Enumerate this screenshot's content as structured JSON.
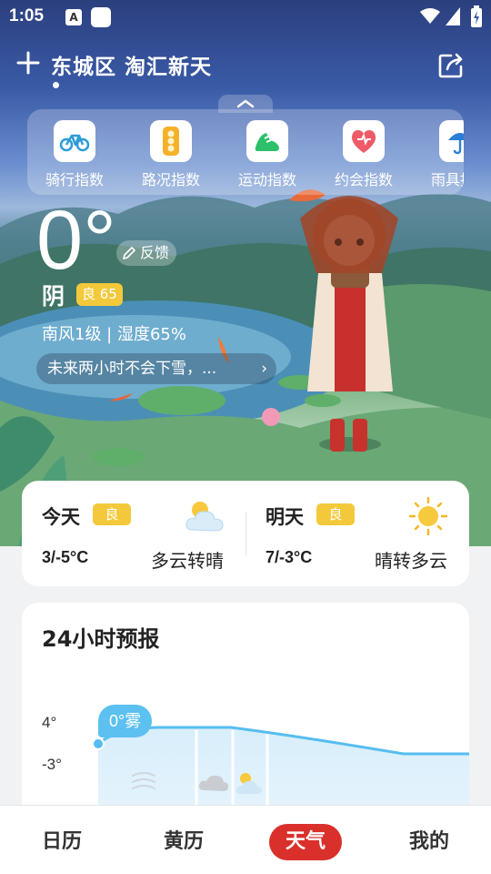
{
  "status_bar": {
    "time": "1:05",
    "notif_a": "A"
  },
  "header": {
    "location": "东城区 淘汇新天"
  },
  "indices": [
    {
      "label": "骑行指数",
      "icon": "bike-icon"
    },
    {
      "label": "路况指数",
      "icon": "traffic-light-icon"
    },
    {
      "label": "运动指数",
      "icon": "running-shoe-icon"
    },
    {
      "label": "约会指数",
      "icon": "heart-icon"
    },
    {
      "label": "雨具指数",
      "icon": "umbrella-icon"
    }
  ],
  "current": {
    "temp": "0°",
    "feedback_label": "反馈",
    "condition": "阴",
    "aqi": "良 65",
    "wind_humidity": "南风1级 | 湿度65%",
    "rain_forecast": "未来两小时不会下雪，..."
  },
  "forecast_days": [
    {
      "name": "今天",
      "quality": "良",
      "range": "3/-5°C",
      "text": "多云转晴",
      "icon": "partly-cloudy-icon"
    },
    {
      "name": "明天",
      "quality": "良",
      "range": "7/-3°C",
      "text": "晴转多云",
      "icon": "sunny-icon"
    }
  ],
  "hourly": {
    "title": "24小时预报",
    "y_max_label": "4°",
    "y_min_label": "-3°",
    "current_bubble": "0°雾"
  },
  "chart_data": {
    "type": "line",
    "title": "24小时预报",
    "ylim": [
      -3,
      4
    ],
    "y_ticks": [
      "4°",
      "-3°"
    ],
    "annotation": "0°雾"
  },
  "nav": {
    "tabs": [
      "日历",
      "黄历",
      "天气",
      "我的"
    ],
    "active": "天气"
  },
  "colors": {
    "accent_red": "#d9302c",
    "aqi_yellow": "#f3c93b",
    "chart_blue": "#5cc0f0"
  }
}
